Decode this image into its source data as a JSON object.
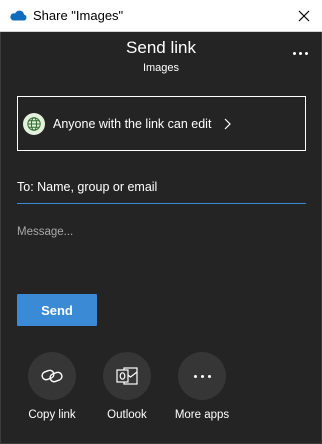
{
  "window": {
    "title": "Share \"Images\"",
    "close_icon": "close-icon",
    "app_icon": "onedrive-cloud-icon"
  },
  "header": {
    "title": "Send link",
    "subtitle": "Images",
    "more_icon": "more-horizontal-icon"
  },
  "permission": {
    "label": "Anyone with the link can edit",
    "icon": "globe-icon",
    "chevron_icon": "chevron-right-icon"
  },
  "recipients": {
    "placeholder": "To: Name, group or email",
    "value": ""
  },
  "message": {
    "placeholder": "Message..."
  },
  "send": {
    "label": "Send"
  },
  "share_apps": [
    {
      "label": "Copy link",
      "icon": "link-icon"
    },
    {
      "label": "Outlook",
      "icon": "outlook-icon"
    },
    {
      "label": "More apps",
      "icon": "more-apps-icon"
    }
  ],
  "colors": {
    "background": "#242424",
    "accent": "#3a8ad6",
    "titlebar": "#ffffff",
    "app_circle": "#363636",
    "globe_bg": "#e3f0dc",
    "globe_stroke": "#2e6b2e",
    "cloud": "#0f6cbd"
  }
}
